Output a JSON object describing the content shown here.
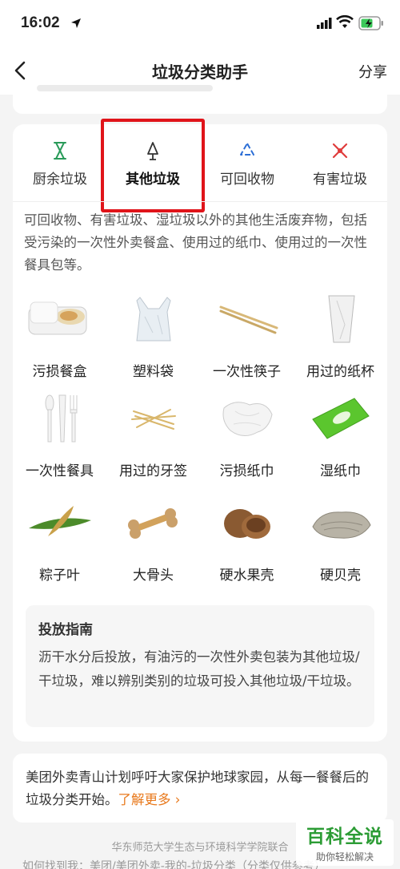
{
  "status_bar": {
    "time": "16:02"
  },
  "nav": {
    "title": "垃圾分类助手",
    "share_label": "分享"
  },
  "tabs": [
    {
      "label": "厨余垃圾",
      "icon": "hourglass-icon",
      "color": "#2a9b5a"
    },
    {
      "label": "其他垃圾",
      "icon": "cone-icon",
      "color": "#333333",
      "active": true
    },
    {
      "label": "可回收物",
      "icon": "recycle-icon",
      "color": "#2d6fd6"
    },
    {
      "label": "有害垃圾",
      "icon": "cross-icon",
      "color": "#e03c3c"
    }
  ],
  "description": "可回收物、有害垃圾、湿垃圾以外的其他生活废弃物，包括受污染的一次性外卖餐盒、使用过的纸巾、使用过的一次性餐具包等。",
  "items": [
    {
      "label": "污损餐盒"
    },
    {
      "label": "塑料袋"
    },
    {
      "label": "一次性筷子"
    },
    {
      "label": "用过的纸杯"
    },
    {
      "label": "一次性餐具"
    },
    {
      "label": "用过的牙签"
    },
    {
      "label": "污损纸巾"
    },
    {
      "label": "湿纸巾"
    },
    {
      "label": "粽子叶"
    },
    {
      "label": "大骨头"
    },
    {
      "label": "硬水果壳"
    },
    {
      "label": "硬贝壳"
    }
  ],
  "guide": {
    "title": "投放指南",
    "text": "沥干水分后投放，有油污的一次性外卖包装为其他垃圾/干垃圾，难以辨别类别的垃圾可投入其他垃圾/干垃圾。"
  },
  "promo": {
    "text": "美团外卖青山计划呼吁大家保护地球家园，从每一餐餐后的垃圾分类开始。",
    "link": "了解更多 ›"
  },
  "footer": {
    "line1": "华东师范大学生态与环境科学学院联合",
    "line2": "如何找到我：美团/美团外卖-我的-垃圾分类（分类仅供参考）"
  },
  "watermark": {
    "main": "百科全说",
    "sub": "助你轻松解决"
  }
}
